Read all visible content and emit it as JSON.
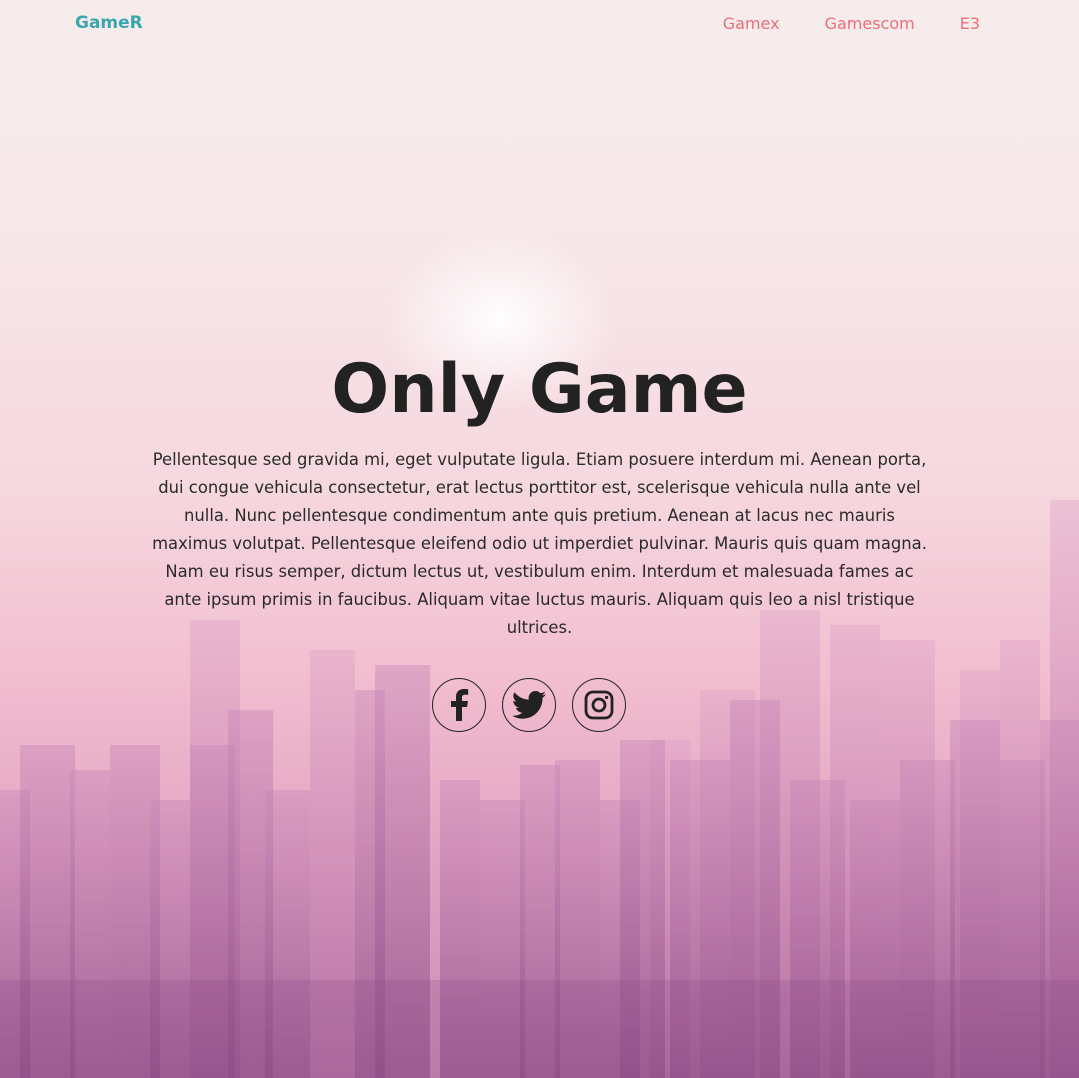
{
  "navbar": {
    "brand": "GameR",
    "links": [
      "Gamex",
      "Gamescom",
      "E3"
    ]
  },
  "hero": {
    "title": "Only Game",
    "description": "Pellentesque sed gravida mi, eget vulputate ligula. Etiam posuere interdum mi. Aenean porta, dui congue vehicula consectetur, erat lectus porttitor est, scelerisque vehicula nulla ante vel nulla. Nunc pellentesque condimentum ante quis pretium. Aenean at lacus nec mauris maximus volutpat. Pellentesque eleifend odio ut imperdiet pulvinar. Mauris quis quam magna. Nam eu risus semper, dictum lectus ut, vestibulum enim. Interdum et malesuada fames ac ante ipsum primis in faucibus. Aliquam vitae luctus mauris. Aliquam quis leo a nisl tristique ultrices."
  },
  "socials": [
    {
      "icon": "facebook-icon"
    },
    {
      "icon": "twitter-icon"
    },
    {
      "icon": "instagram-icon"
    }
  ],
  "colors": {
    "brand": "#3aa6b0",
    "nav_link": "#ee6d78",
    "text": "#222222"
  }
}
